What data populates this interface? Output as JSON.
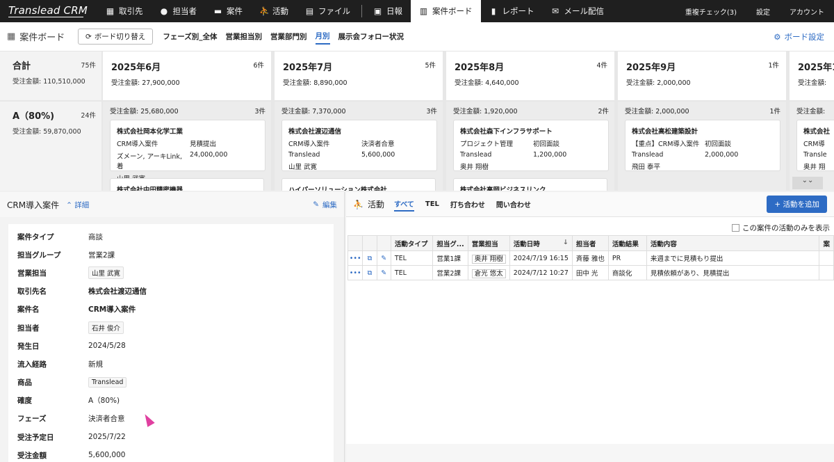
{
  "logo": "Translead CRM",
  "nav": {
    "items": [
      {
        "label": "取引先",
        "icon": "building-icon",
        "glyph": "▦"
      },
      {
        "label": "担当者",
        "icon": "person-icon",
        "glyph": "●"
      },
      {
        "label": "案件",
        "icon": "briefcase-icon",
        "glyph": "▬"
      },
      {
        "label": "活動",
        "icon": "running-icon",
        "glyph": "⛹"
      },
      {
        "label": "ファイル",
        "icon": "file-icon",
        "glyph": "▤"
      },
      {
        "label": "日報",
        "icon": "report-icon",
        "glyph": "▣"
      },
      {
        "label": "案件ボード",
        "icon": "board-icon",
        "glyph": "▥"
      },
      {
        "label": "レポート",
        "icon": "bar-chart-icon",
        "glyph": "▮"
      },
      {
        "label": "メール配信",
        "icon": "mail-icon",
        "glyph": "✉"
      }
    ],
    "right": [
      "重複チェック(3)",
      "設定",
      "アカウント"
    ]
  },
  "board": {
    "title": "案件ボード",
    "switch_label": "ボード切り替え",
    "tabs": [
      "フェーズ別_全体",
      "営業担当別",
      "営業部門別",
      "月別",
      "展示会フォロー状況"
    ],
    "active_tab": "月別",
    "settings_label": "ボード設定"
  },
  "kanban": {
    "total": {
      "name": "合計",
      "count": "75件",
      "amount": "受注金額: 110,510,000"
    },
    "row": {
      "name": "A（80%)",
      "count": "24件",
      "amount": "受注金額: 59,870,000"
    },
    "columns": [
      {
        "name": "2025年6月",
        "count": "6件",
        "amount": "受注金額: 27,900,000",
        "row_amount": "受注金額: 25,680,000",
        "row_count": "3件",
        "card": {
          "company": "株式会社岡本化学工業",
          "deal": "CRM導入案件",
          "phase": "見積提出",
          "contact": "ズメーン, アーキLink, 着",
          "value": "24,000,000",
          "owner": "山里 武寛"
        },
        "next": "株式会社中田精密機器"
      },
      {
        "name": "2025年7月",
        "count": "5件",
        "amount": "受注金額: 8,890,000",
        "row_amount": "受注金額: 7,370,000",
        "row_count": "3件",
        "card": {
          "company": "株式会社渡辺通信",
          "deal": "CRM導入案件",
          "phase": "決済者合意",
          "contact": "Translead",
          "value": "5,600,000",
          "owner": "山里 武寛"
        },
        "next": "ハイパーソリューション株式会社"
      },
      {
        "name": "2025年8月",
        "count": "4件",
        "amount": "受注金額: 4,640,000",
        "row_amount": "受注金額: 1,920,000",
        "row_count": "2件",
        "card": {
          "company": "株式会社森下インフラサポート",
          "deal": "プロジェクト管理",
          "phase": "初回面談",
          "contact": "Translead",
          "value": "1,200,000",
          "owner": "奥井 翔樹"
        },
        "next": "株式会社高岡ビジネスリンク"
      },
      {
        "name": "2025年9月",
        "count": "1件",
        "amount": "受注金額: 2,000,000",
        "row_amount": "受注金額: 2,000,000",
        "row_count": "1件",
        "card": {
          "company": "株式会社高松建築設計",
          "deal": "【重点】CRM導入案件",
          "phase": "初回面談",
          "contact": "Translead",
          "value": "2,000,000",
          "owner": "飛田 泰平"
        },
        "next": ""
      },
      {
        "name": "2025年1",
        "count": "",
        "amount": "受注金額:",
        "row_amount": "受注金額:",
        "row_count": "",
        "card": {
          "company": "株式会社",
          "deal": "CRM導",
          "phase": "",
          "contact": "Transle",
          "value": "",
          "owner": "奥井 翔"
        },
        "next": ""
      }
    ]
  },
  "detail": {
    "title": "CRM導入案件",
    "detail_link": "詳細",
    "edit_label": "編集",
    "fields": [
      {
        "label": "案件タイプ",
        "value": "商談",
        "style": "plain"
      },
      {
        "label": "担当グループ",
        "value": "営業2課",
        "style": "plain"
      },
      {
        "label": "営業担当",
        "value": "山里 武寛",
        "style": "chip"
      },
      {
        "label": "取引先名",
        "value": "株式会社渡辺通信",
        "style": "bold"
      },
      {
        "label": "案件名",
        "value": "CRM導入案件",
        "style": "bold"
      },
      {
        "label": "担当者",
        "value": "石井 俊介",
        "style": "chip"
      },
      {
        "label": "発生日",
        "value": "2024/5/28",
        "style": "plain"
      },
      {
        "label": "流入経路",
        "value": "新規",
        "style": "plain"
      },
      {
        "label": "商品",
        "value": "Translead",
        "style": "chip"
      },
      {
        "label": "確度",
        "value": "A（80%)",
        "style": "plain"
      },
      {
        "label": "フェーズ",
        "value": "決済者合意",
        "style": "plain"
      },
      {
        "label": "受注予定日",
        "value": "2025/7/22",
        "style": "plain"
      },
      {
        "label": "受注金額",
        "value": "5,600,000",
        "style": "plain"
      }
    ]
  },
  "activity": {
    "title": "活動",
    "tabs": [
      "すべて",
      "TEL",
      "打ち合わせ",
      "問い合わせ"
    ],
    "active_tab": "すべて",
    "add_label": "+ 活動を追加",
    "only_label": "この案件の活動のみを表示",
    "columns": [
      "活動タイプ",
      "担当グ...",
      "営業担当",
      "活動日時",
      "担当者",
      "活動結果",
      "活動内容",
      "案"
    ],
    "rows": [
      {
        "type": "TEL",
        "group": "営業1課",
        "sales": "奥井 翔樹",
        "datetime": "2024/7/19 16:15",
        "person": "斉藤 雅也",
        "result": "PR",
        "content": "来週までに見積もり提出"
      },
      {
        "type": "TEL",
        "group": "営業2課",
        "sales": "倉光 悠太",
        "datetime": "2024/7/12 10:27",
        "person": "田中 光",
        "result": "商談化",
        "content": "見積依頼があり、見積提出"
      }
    ]
  },
  "colors": {
    "accent": "#2d6bc4",
    "nav_bg": "#1f1f1f",
    "cursor": "#e040a0"
  }
}
